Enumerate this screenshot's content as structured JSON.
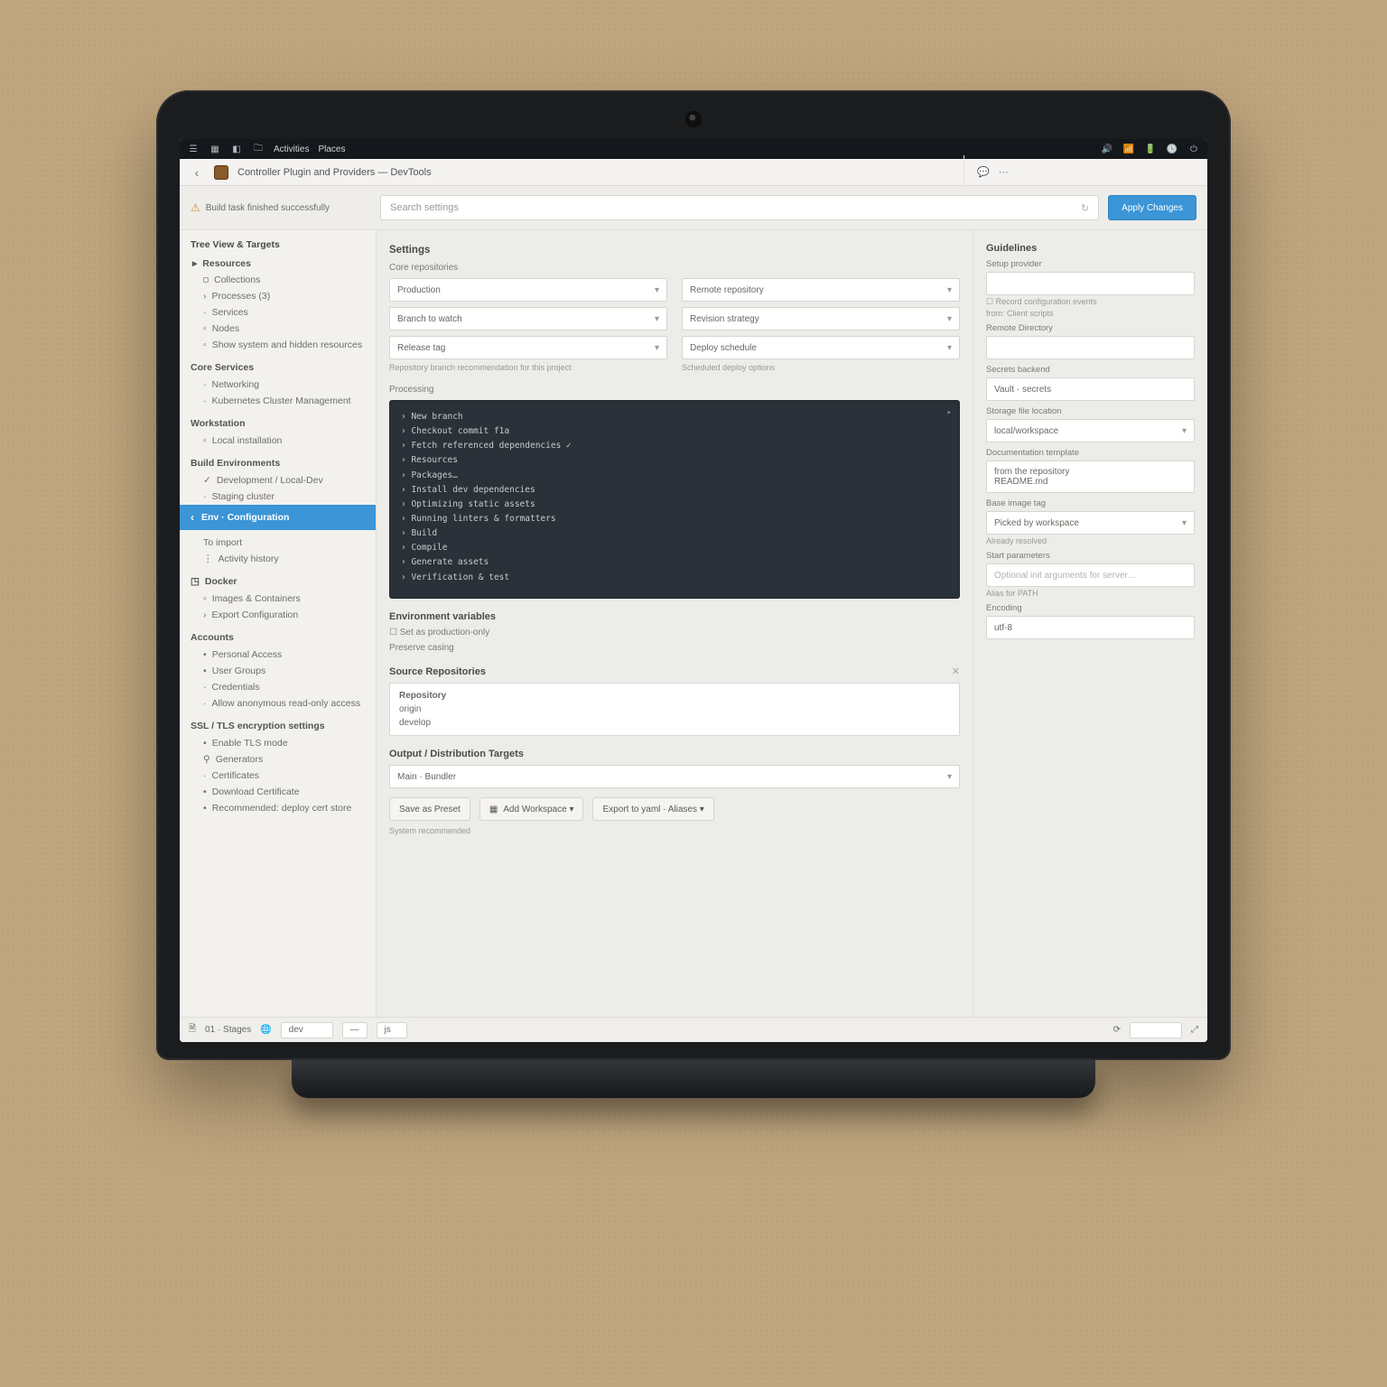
{
  "os": {
    "left": [
      "Activities",
      "Places"
    ],
    "right_icons": [
      "speaker",
      "wifi",
      "battery",
      "clock",
      "power"
    ]
  },
  "window": {
    "title": "Controller Plugin and Providers — DevTools",
    "right_icons": [
      "chat",
      "menu"
    ]
  },
  "toolbar": {
    "notice": "Build task finished successfully",
    "search_placeholder": "Search settings",
    "primary": "Apply Changes"
  },
  "sidebar": {
    "heading": "Tree View & Targets",
    "g1": {
      "title": "Resources",
      "items": [
        "Collections",
        "Processes  (3)",
        "Services",
        "Nodes",
        "Show system and hidden resources"
      ]
    },
    "g2": {
      "title": "Core Services",
      "items": [
        "Networking",
        "Kubernetes Cluster Management"
      ]
    },
    "g3": {
      "title": "Workstation",
      "items": [
        "Local installation"
      ]
    },
    "g4": {
      "title": "Build Environments",
      "items": [
        "Development / Local-Dev",
        "Staging cluster"
      ]
    },
    "active": "Env · Configuration",
    "after_active": "To import",
    "after_active2": "Activity history",
    "g5": {
      "title": "Docker",
      "items": [
        "Images & Containers",
        "Export Configuration"
      ]
    },
    "g6": {
      "title": "Accounts",
      "items": [
        "Personal Access",
        "User Groups",
        "Credentials",
        "Allow anonymous read-only access"
      ]
    },
    "g7": {
      "title": "SSL / TLS encryption settings",
      "items": [
        "Enable TLS mode",
        "Generators",
        "Certificates",
        "Download Certificate",
        "Recommended: deploy cert store"
      ]
    }
  },
  "main": {
    "title": "Settings",
    "row_a": {
      "sub": "Core repositories",
      "left": "Production",
      "left2": "Branch to watch",
      "left3": "Release tag",
      "left_hint": "Repository branch recommendation for this project",
      "right": "Remote repository",
      "right2": "Revision strategy",
      "right3": "Deploy schedule",
      "right_hint": "Scheduled deploy options"
    },
    "terminal_label": "Processing",
    "terminal": {
      "tab": "▸",
      "lines": [
        "› New branch",
        "› Checkout commit f1a",
        "› Fetch referenced dependencies  ✓",
        "› Resources",
        "› Packages…",
        "› Install dev dependencies",
        "› Optimizing static assets",
        "› Running linters & formatters",
        "› Build",
        "› Compile",
        "› Generate assets",
        "› Verification & test"
      ]
    },
    "block1": {
      "title": "Environment variables",
      "lines": [
        "Set as production-only",
        "Preserve casing"
      ]
    },
    "block2": {
      "title": "Source Repositories",
      "x": "✕",
      "rows": [
        "Repository",
        "origin",
        "develop"
      ]
    },
    "block3": {
      "title": "Output / Distribution Targets",
      "select": "Main · Bundler"
    },
    "buttons": {
      "a": "Save as Preset",
      "b": "Add Workspace  ▾",
      "c": "Export to yaml · Aliases  ▾"
    },
    "footnote": "System recommended"
  },
  "rightcol": {
    "title": "Guidelines",
    "sub": "Setup provider",
    "field0": "",
    "chk": "Record configuration events",
    "small0": "from: Client scripts",
    "l1": "Remote Directory",
    "f1": "",
    "l2": "Secrets backend",
    "f2": "Vault · secrets",
    "l3": "Storage file location",
    "f3": "local/workspace",
    "small3": "",
    "l4": "Documentation template",
    "f4_a": "from the repository",
    "f4_b": "README.md",
    "small4": "",
    "l5": "Base image tag",
    "f5": "Picked by workspace",
    "small5": "Already resolved",
    "l6": "Start parameters",
    "f6": "Optional init arguments for server…",
    "small6": "Alias for PATH",
    "l7": "Encoding",
    "f7": "utf-8"
  },
  "status": {
    "left_label": "01 · Stages",
    "sel1": "dev",
    "sel1b": "—",
    "sel2": "js",
    "right_field": "",
    "right_icons": [
      "sync",
      "expand"
    ]
  }
}
